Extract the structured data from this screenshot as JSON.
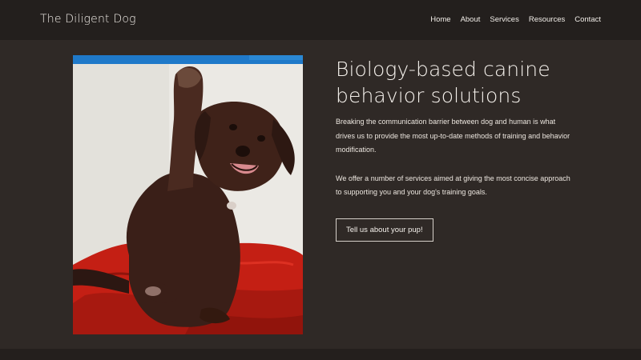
{
  "header": {
    "brand": "The Diligent Dog",
    "nav": [
      "Home",
      "About",
      "Services",
      "Resources",
      "Contact"
    ]
  },
  "hero": {
    "headline": "Biology-based canine behavior solutions",
    "paragraph_1": "Breaking the communication barrier between dog and human is what drives us to provide the most up-to-date methods of training and behavior modification.",
    "paragraph_2": "We offer a number of services aimed at giving the most concise approach to supporting you and your dog's training goals.",
    "cta_label": "Tell us about your pup!"
  },
  "colors": {
    "page_bg": "#2f2926",
    "header_bg": "#231f1d",
    "text": "#f2eee9",
    "accent_blue": "#1f79c9",
    "blanket_red": "#c41f14"
  }
}
